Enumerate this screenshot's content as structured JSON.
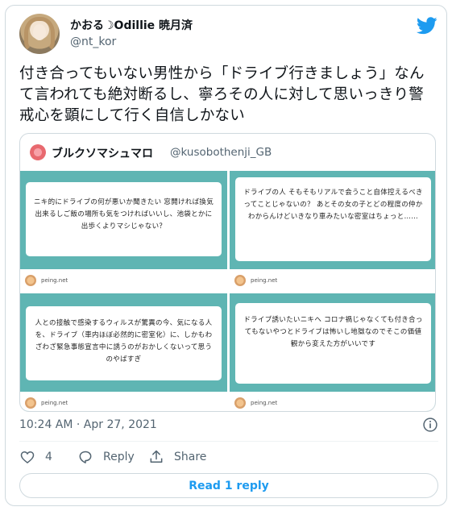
{
  "author": {
    "display_name": "かおる☽Odillie 暁月済",
    "handle": "@nt_kor"
  },
  "tweet": {
    "text": "付き合ってもいない男性から「ドライブ行きましょう」なんて言われても絶対断るし、寧ろその人に対して思いっきり警戒心を顕にして行く自信しかない",
    "timestamp": "10:24 AM · Apr 27, 2021",
    "likes": "4",
    "reply_label": "Reply",
    "share_label": "Share",
    "read_replies": "Read 1 reply"
  },
  "quoted": {
    "name": "ブルクソマシュマロ",
    "handle": "@kusobothenji_GB",
    "cards": [
      {
        "text": "ニキ的にドライブの何が悪いか聞きたい 窓開ければ換気出来るしご飯の場所も気をつければいいし、池袋とかに出歩くよりマシじゃない？",
        "site": "peing.net"
      },
      {
        "text": "ドライブの人 そもそもリアルで会うこと自体控えるべきってことじゃないの？ あとその女の子とどの程度の仲かわからんけどいきなり車みたいな密室はちょっと……",
        "site": "peing.net"
      },
      {
        "text": "人との接触で感染するウィルスが驚異の今、気になる人を、ドライブ（車内ほぼ必然的に密室化）に、しかもわざわざ緊急事態宣言中に誘うのがおかしくないって思うのやばすぎ",
        "site": "peing.net"
      },
      {
        "text": "ドライブ誘いたいニキへ コロナ禍じゃなくても付き合ってもないやつとドライブは怖いし地獄なのでそこの価値観から変えた方がいいです",
        "site": "peing.net"
      }
    ]
  },
  "colors": {
    "accent": "#1d9bf0",
    "card_teal": "#5fb5b3",
    "muted_text": "#536471"
  },
  "icons": [
    "twitter-bird-icon",
    "info-icon",
    "heart-icon",
    "reply-icon",
    "share-icon"
  ]
}
